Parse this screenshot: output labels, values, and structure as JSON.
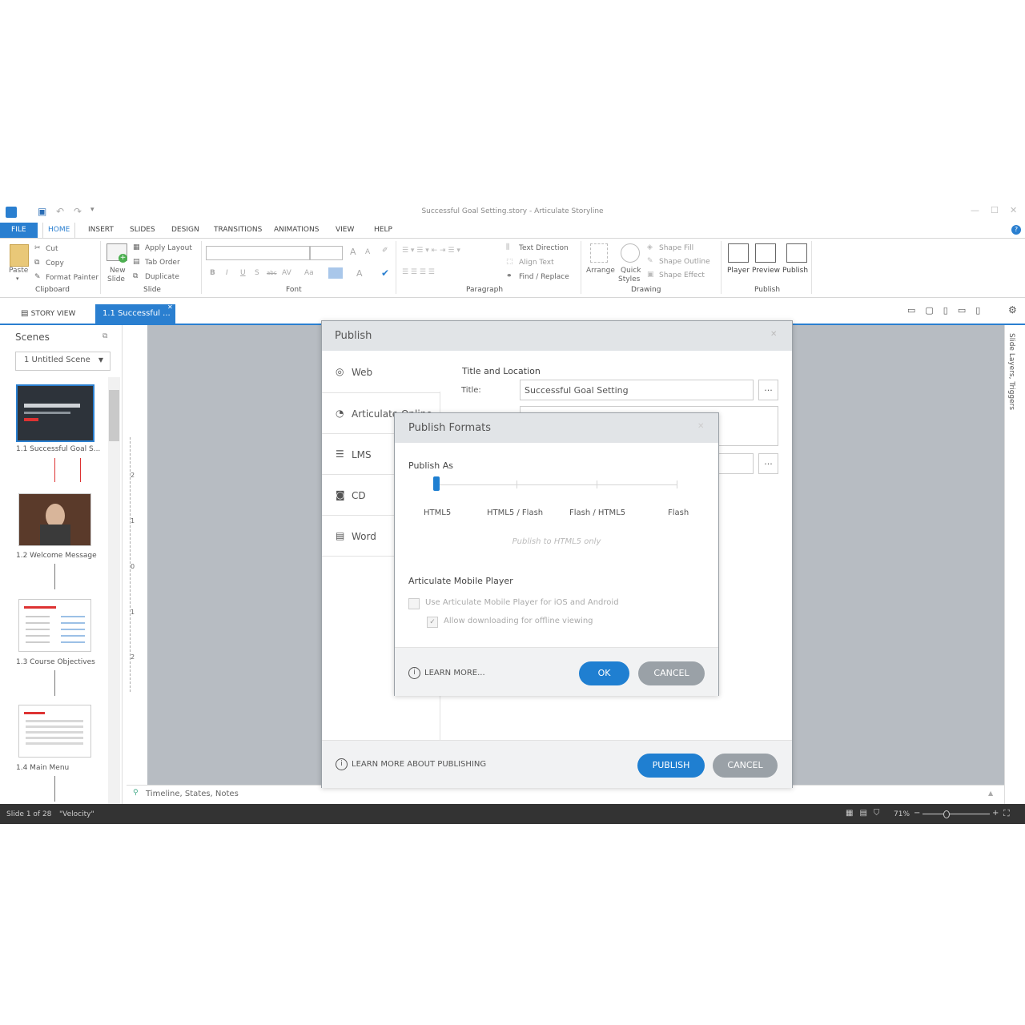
{
  "window": {
    "title": "Successful Goal Setting.story - Articulate Storyline",
    "controls": {
      "minimize": "—",
      "maximize": "☐",
      "close": "✕"
    }
  },
  "quick_access": {
    "save_icon": "save-icon",
    "undo_icon": "undo-icon",
    "redo_icon": "redo-icon"
  },
  "ribbon": {
    "tabs": [
      "FILE",
      "HOME",
      "INSERT",
      "SLIDES",
      "DESIGN",
      "TRANSITIONS",
      "ANIMATIONS",
      "VIEW",
      "HELP"
    ],
    "active_tab": "HOME",
    "clipboard": {
      "paste": "Paste",
      "cut": "Cut",
      "copy": "Copy",
      "format_painter": "Format Painter",
      "group": "Clipboard"
    },
    "slide": {
      "new_slide": "New",
      "new_slide2": "Slide",
      "apply_layout": "Apply Layout",
      "tab_order": "Tab Order",
      "duplicate": "Duplicate",
      "group": "Slide"
    },
    "font": {
      "group": "Font",
      "bold": "B",
      "italic": "I",
      "underline": "U",
      "strike": "S",
      "abc": "abc",
      "av": "AV",
      "aa": "Aa",
      "grow": "A",
      "shrink": "A",
      "color_a": "A"
    },
    "paragraph": {
      "group": "Paragraph",
      "text_direction": "Text Direction",
      "align_text": "Align Text",
      "find_replace": "Find / Replace"
    },
    "drawing": {
      "group": "Drawing",
      "arrange": "Arrange",
      "quick_styles": "Quick",
      "quick_styles2": "Styles",
      "shape_fill": "Shape Fill",
      "shape_outline": "Shape Outline",
      "shape_effect": "Shape Effect"
    },
    "publish": {
      "group": "Publish",
      "player": "Player",
      "preview": "Preview",
      "publish": "Publish"
    }
  },
  "view_tabs": {
    "story_view": "STORY VIEW",
    "slide_tab": "1.1 Successful ..."
  },
  "scenes": {
    "header": "Scenes",
    "dropdown": "1  Untitled Scene",
    "items": [
      {
        "caption": "1.1 Successful Goal S..."
      },
      {
        "caption": "1.2 Welcome Message"
      },
      {
        "caption": "1.3 Course Objectives"
      },
      {
        "caption": "1.4 Main Menu"
      }
    ]
  },
  "ruler_marks": [
    "2",
    "1",
    "0",
    "1",
    "2"
  ],
  "right_panel": {
    "label": "Slide Layers, Triggers"
  },
  "timeline_bar": {
    "label": "Timeline, States, Notes"
  },
  "status_bar": {
    "slide": "Slide 1 of 28",
    "theme": "\"Velocity\"",
    "zoom": "71%"
  },
  "publish_dialog": {
    "title": "Publish",
    "nav": [
      "Web",
      "Articulate Online",
      "LMS",
      "CD",
      "Word"
    ],
    "active_nav": "Web",
    "section": "Title and Location",
    "title_label": "Title:",
    "title_value": "Successful Goal Setting",
    "browse": "...",
    "learn_more": "LEARN MORE ABOUT PUBLISHING",
    "publish_btn": "PUBLISH",
    "cancel_btn": "CANCEL"
  },
  "formats_dialog": {
    "title": "Publish Formats",
    "publish_as": "Publish As",
    "options": [
      "HTML5",
      "HTML5 / Flash",
      "Flash / HTML5",
      "Flash"
    ],
    "selected_option_index": 0,
    "hint": "Publish to HTML5 only",
    "mobile_section": "Articulate Mobile Player",
    "use_mobile": "Use Articulate Mobile Player for iOS and Android",
    "use_mobile_checked": false,
    "allow_offline": "Allow downloading for offline viewing",
    "allow_offline_checked": true,
    "learn_more": "LEARN MORE...",
    "ok": "OK",
    "cancel": "CANCEL"
  },
  "colors": {
    "accent": "#2a7fd0",
    "button_grey": "#9aa1a7",
    "canvas": "#b7bcc2"
  }
}
